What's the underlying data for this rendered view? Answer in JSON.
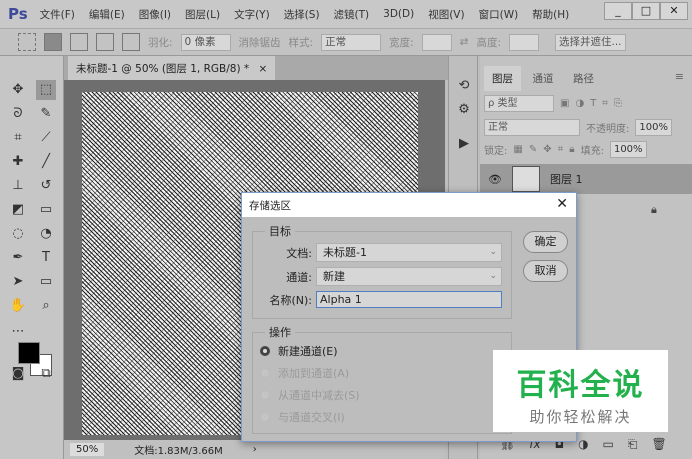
{
  "app": {
    "logo": "Ps",
    "menus": [
      "文件(F)",
      "编辑(E)",
      "图像(I)",
      "图层(L)",
      "文字(Y)",
      "选择(S)",
      "滤镜(T)",
      "3D(D)",
      "视图(V)",
      "窗口(W)",
      "帮助(H)"
    ],
    "window_buttons": [
      "_",
      "□",
      "✕"
    ]
  },
  "options": {
    "feather_label": "羽化:",
    "feather_value": "0 像素",
    "antialias_label": "消除锯齿",
    "style_label": "样式:",
    "style_value": "正常",
    "width_label": "宽度:",
    "height_label": "高度:",
    "select_mask_label": "选择并遮住..."
  },
  "document_tab": {
    "title": "未标题-1 @ 50% (图层 1, RGB/8) *",
    "close": "×"
  },
  "status": {
    "zoom": "50%",
    "doc_size": "文档:1.83M/3.66M",
    "arrow": "›"
  },
  "layers_panel": {
    "tabs": [
      "图层",
      "通道",
      "路径"
    ],
    "filter_label": "ρ 类型",
    "blend_mode": "正常",
    "opacity_label": "不透明度:",
    "opacity_value": "100%",
    "lock_label": "锁定:",
    "fill_label": "填充:",
    "fill_value": "100%",
    "layer_name": "图层 1",
    "bottom_icons": [
      "link",
      "fx",
      "mask",
      "adjust",
      "folder",
      "new",
      "trash"
    ]
  },
  "dialog": {
    "title": "存储选区",
    "close": "✕",
    "target_legend": "目标",
    "doc_label": "文档:",
    "doc_value": "未标题-1",
    "channel_label": "通道:",
    "channel_value": "新建",
    "name_label": "名称(N):",
    "name_value": "Alpha 1",
    "ok": "确定",
    "cancel": "取消",
    "operation_legend": "操作",
    "options": [
      "新建通道(E)",
      "添加到通道(A)",
      "从通道中减去(S)",
      "与通道交叉(I)"
    ],
    "selected_option": 0
  },
  "watermark": {
    "line1": "百科全说",
    "line2": "助你轻松解决",
    "color": "#22b14c"
  }
}
